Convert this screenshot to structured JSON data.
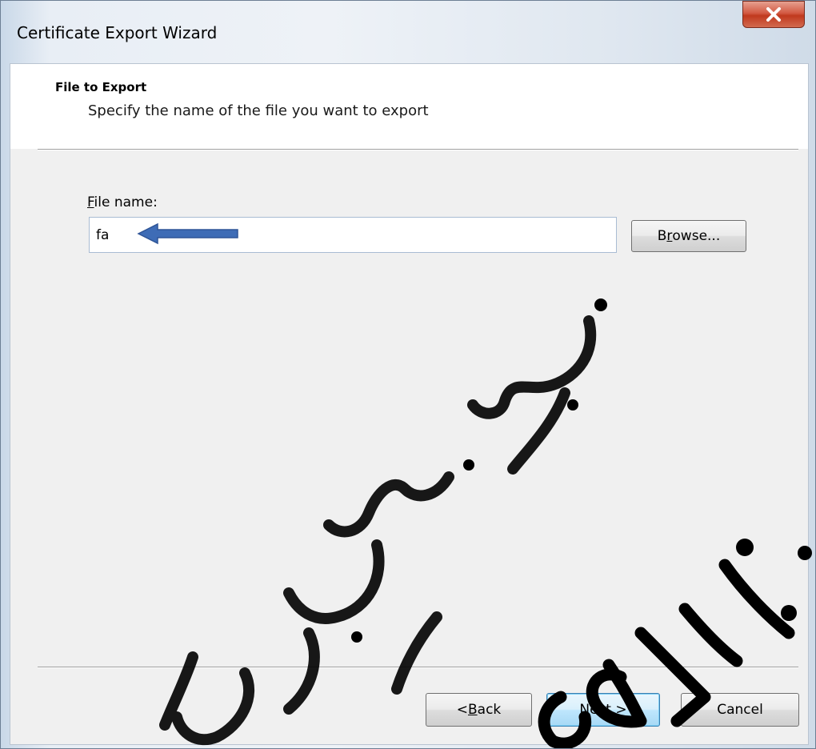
{
  "window": {
    "title": "Certificate Export Wizard"
  },
  "header": {
    "title": "File to Export",
    "subtitle": "Specify the name of the file you want to export"
  },
  "form": {
    "file_label_accel": "F",
    "file_label_rest": "ile name:",
    "file_value": "fa",
    "browse_pre": "B",
    "browse_accel": "r",
    "browse_post": "owse..."
  },
  "buttons": {
    "back_pre": "< ",
    "back_accel": "B",
    "back_post": "ack",
    "next_accel": "N",
    "next_post": "ext >",
    "cancel": "Cancel"
  },
  "annotation": {
    "arrow_color": "#3e6cb6"
  },
  "watermark_text": "aki.ir",
  "colors": {
    "close_button": "#c9442a",
    "next_button_border": "#3c7fb1"
  }
}
